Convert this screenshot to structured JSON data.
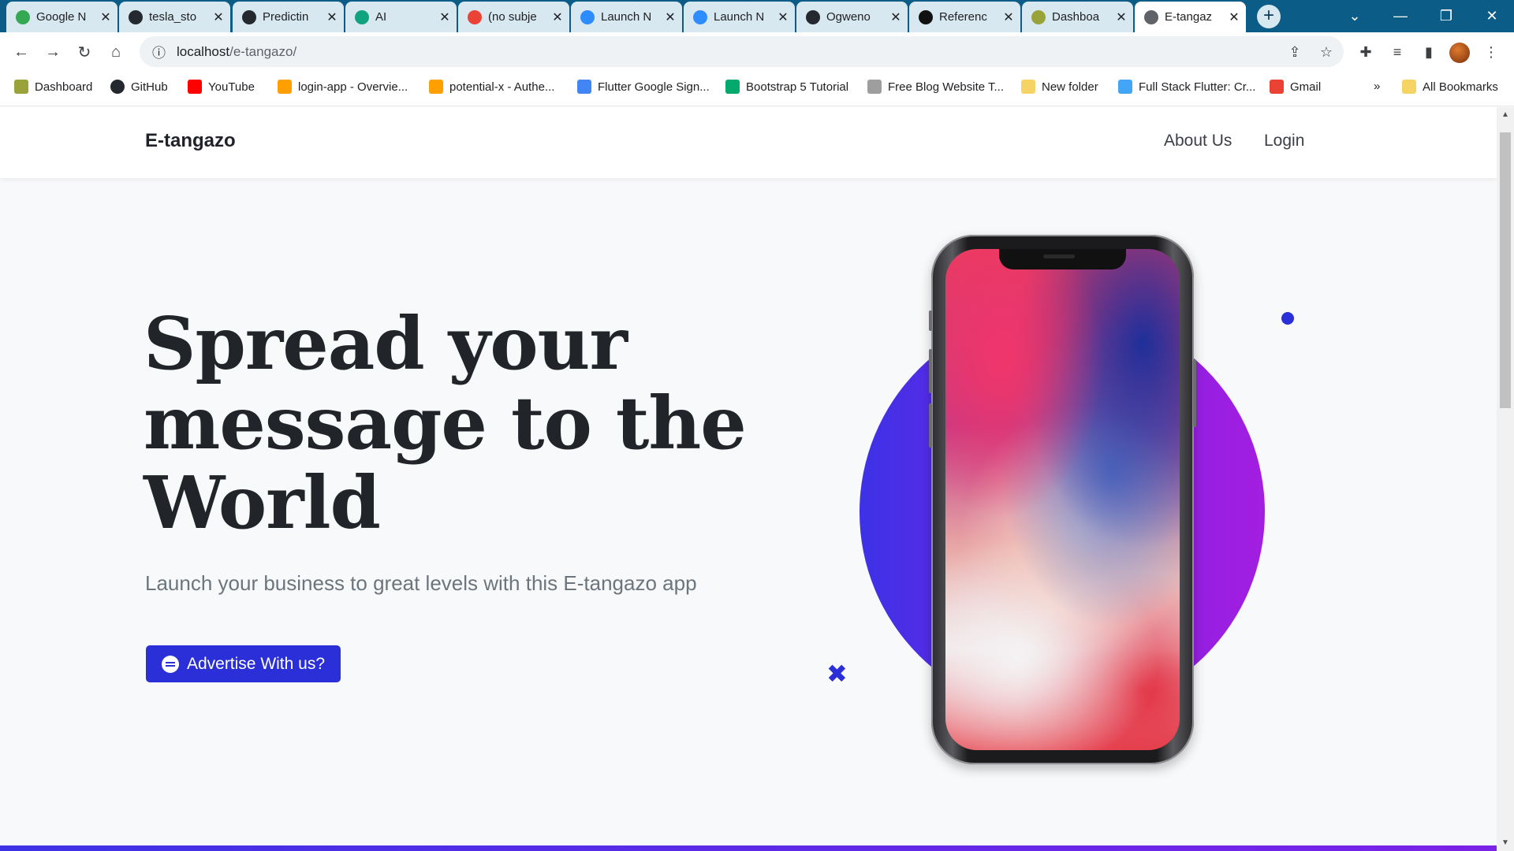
{
  "browser": {
    "tabs": [
      {
        "title": "Google N",
        "icon": "google-maps-icon",
        "color": "#34a853"
      },
      {
        "title": "tesla_sto",
        "icon": "github-icon",
        "color": "#24292f"
      },
      {
        "title": "Predictin",
        "icon": "github-icon",
        "color": "#24292f"
      },
      {
        "title": "AI",
        "icon": "openai-icon",
        "color": "#10a37f"
      },
      {
        "title": "(no subje",
        "icon": "gmail-icon",
        "color": "#ea4335"
      },
      {
        "title": "Launch N",
        "icon": "zoom-icon",
        "color": "#2d8cff"
      },
      {
        "title": "Launch N",
        "icon": "zoom-icon",
        "color": "#2d8cff"
      },
      {
        "title": "Ogweno",
        "icon": "github-icon",
        "color": "#24292f"
      },
      {
        "title": "Referenc",
        "icon": "reference-icon",
        "color": "#111111"
      },
      {
        "title": "Dashboa",
        "icon": "dashboard-icon",
        "color": "#9aa33a"
      },
      {
        "title": "E-tangaz",
        "icon": "globe-icon",
        "color": "#5f6368"
      }
    ],
    "close_glyph": "✕",
    "new_tab_glyph": "+",
    "window_controls": {
      "tabsearch": "⌄",
      "minimize": "—",
      "restore": "❐",
      "close": "✕"
    },
    "url_host": "localhost",
    "url_path": "/e-tangazo/",
    "nav": {
      "back": "←",
      "forward": "→",
      "reload": "↻",
      "home": "⌂",
      "info": "ⓘ"
    },
    "omni_icons": {
      "share": "⇪",
      "star": "☆",
      "extensions": "✚",
      "media": "≡",
      "sidepanel": "▮",
      "menu": "⋮"
    },
    "bookmarks": [
      {
        "label": "Dashboard",
        "color": "#9aa33a"
      },
      {
        "label": "GitHub",
        "color": "#24292f"
      },
      {
        "label": "YouTube",
        "color": "#ff0000"
      },
      {
        "label": "login-app - Overvie...",
        "color": "#ffa000"
      },
      {
        "label": "potential-x - Authe...",
        "color": "#ffa000"
      },
      {
        "label": "Flutter Google Sign...",
        "color": "#4285f4"
      },
      {
        "label": "Bootstrap 5 Tutorial",
        "color": "#04aa6d"
      },
      {
        "label": "Free Blog Website T...",
        "color": "#9e9e9e"
      },
      {
        "label": "New folder",
        "color": "#f6d365"
      },
      {
        "label": "Full Stack Flutter: Cr...",
        "color": "#42a5f5"
      },
      {
        "label": "Gmail",
        "color": "#ea4335"
      }
    ],
    "more_bookmarks": "»",
    "all_bookmarks": "All Bookmarks"
  },
  "site": {
    "brand": "E-tangazo",
    "nav": {
      "about": "About Us",
      "login": "Login"
    },
    "hero": {
      "title_lines": [
        "Spread your",
        "message to the",
        "World"
      ],
      "subtitle": "Launch your business to great levels with this E-tangazo app",
      "cta_label": "Advertise With us?"
    },
    "accent_color": "#2a2fd8",
    "decor": {
      "xmark": "✖"
    }
  },
  "scrollbar": {
    "up": "▲",
    "down": "▼"
  }
}
